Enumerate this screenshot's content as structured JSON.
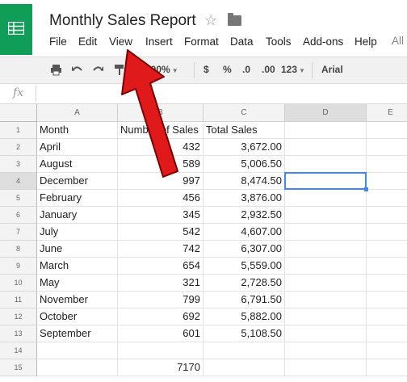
{
  "document": {
    "title": "Monthly Sales Report"
  },
  "menu": {
    "items": [
      {
        "key": "file",
        "label": "File"
      },
      {
        "key": "edit",
        "label": "Edit"
      },
      {
        "key": "view",
        "label": "View"
      },
      {
        "key": "insert",
        "label": "Insert"
      },
      {
        "key": "format",
        "label": "Format"
      },
      {
        "key": "data",
        "label": "Data"
      },
      {
        "key": "tools",
        "label": "Tools"
      },
      {
        "key": "addons",
        "label": "Add-ons"
      },
      {
        "key": "help",
        "label": "Help"
      }
    ],
    "truncated": "All"
  },
  "toolbar": {
    "zoom": "100%",
    "currency": "$",
    "percent": "%",
    "dec_decrease": ".0",
    "dec_increase": ".00",
    "more_formats": "123",
    "font": "Arial"
  },
  "formula_bar": {
    "fx_label": "fx",
    "value": ""
  },
  "grid": {
    "columns": [
      "A",
      "B",
      "C",
      "D",
      "E"
    ],
    "rows": [
      {
        "n": "1",
        "a": "Month",
        "b": "Number of Sales",
        "c": "Total Sales"
      },
      {
        "n": "2",
        "a": "April",
        "b": "432",
        "c": "3,672.00"
      },
      {
        "n": "3",
        "a": "August",
        "b": "589",
        "c": "5,006.50"
      },
      {
        "n": "4",
        "a": "December",
        "b": "997",
        "c": "8,474.50"
      },
      {
        "n": "5",
        "a": "February",
        "b": "456",
        "c": "3,876.00"
      },
      {
        "n": "6",
        "a": "January",
        "b": "345",
        "c": "2,932.50"
      },
      {
        "n": "7",
        "a": "July",
        "b": "542",
        "c": "4,607.00"
      },
      {
        "n": "8",
        "a": "June",
        "b": "742",
        "c": "6,307.00"
      },
      {
        "n": "9",
        "a": "March",
        "b": "654",
        "c": "5,559.00"
      },
      {
        "n": "10",
        "a": "May",
        "b": "321",
        "c": "2,728.50"
      },
      {
        "n": "11",
        "a": "November",
        "b": "799",
        "c": "6,791.50"
      },
      {
        "n": "12",
        "a": "October",
        "b": "692",
        "c": "5,882.00"
      },
      {
        "n": "13",
        "a": "September",
        "b": "601",
        "c": "5,108.50"
      },
      {
        "n": "14",
        "a": "",
        "b": "",
        "c": ""
      },
      {
        "n": "15",
        "a": "",
        "b": "7170",
        "c": ""
      }
    ],
    "selected_cell": "D4"
  },
  "colors": {
    "brand": "#0f9d58",
    "selection": "#4285f4",
    "arrow": "#e0191a"
  }
}
